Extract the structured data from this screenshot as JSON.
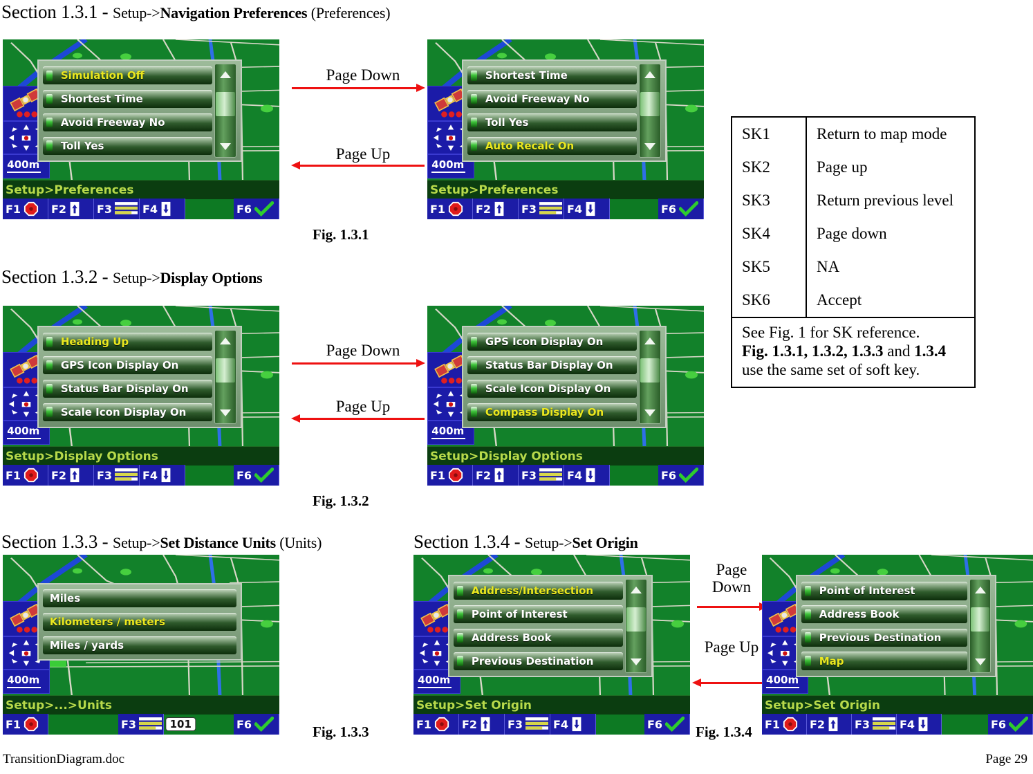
{
  "document": {
    "footer_left": "TransitionDiagram.doc",
    "footer_right": "Page 29"
  },
  "colors": {
    "arrow": "#ee1111",
    "screen_bg": "#12812a",
    "softkey_blue": "#1c1ca6",
    "selected_text": "#ebe81f",
    "status_text": "#b7d94a"
  },
  "sections": {
    "s131": {
      "prefix": "Section 1.3.1 - ",
      "path_plain": "Setup->",
      "path_bold": "Navigation Preferences",
      "suffix": " (Preferences)",
      "caption": "Fig. 1.3.1",
      "arrow_down_label": "Page Down",
      "arrow_up_label": "Page Up"
    },
    "s132": {
      "prefix": "Section 1.3.2 - ",
      "path_plain": "Setup->",
      "path_bold": "Display Options",
      "suffix": "",
      "caption": "Fig. 1.3.2",
      "arrow_down_label": "Page Down",
      "arrow_up_label": "Page Up"
    },
    "s133": {
      "prefix": "Section 1.3.3 - ",
      "path_plain": "Setup->",
      "path_bold": "Set Distance Units",
      "suffix": " (Units)",
      "caption": "Fig. 1.3.3"
    },
    "s134": {
      "prefix": "Section 1.3.4 - ",
      "path_plain": "Setup->",
      "path_bold": "Set Origin",
      "suffix": "",
      "caption": "Fig. 1.3.4",
      "arrow_down_label": "Page\nDown",
      "arrow_up_label": "Page\nUp"
    }
  },
  "screens": {
    "nav_prefs_page1": {
      "status": "Setup>Preferences",
      "scale": "400m",
      "items": [
        {
          "label": "Simulation Off",
          "selected": true
        },
        {
          "label": "Shortest Time",
          "selected": false
        },
        {
          "label": "Avoid Freeway No",
          "selected": false
        },
        {
          "label": "Toll Yes",
          "selected": false
        }
      ],
      "scrollbar": true,
      "softkeys": [
        "F1",
        "F2",
        "F3",
        "F4",
        "F6"
      ]
    },
    "nav_prefs_page2": {
      "status": "Setup>Preferences",
      "scale": "400m",
      "items": [
        {
          "label": "Shortest Time",
          "selected": false
        },
        {
          "label": "Avoid Freeway No",
          "selected": false
        },
        {
          "label": "Toll Yes",
          "selected": false
        },
        {
          "label": "Auto Recalc On",
          "selected": true
        }
      ],
      "scrollbar": true,
      "softkeys": [
        "F1",
        "F2",
        "F3",
        "F4",
        "F6"
      ]
    },
    "display_page1": {
      "status": "Setup>Display Options",
      "scale": "400m",
      "items": [
        {
          "label": "Heading Up",
          "selected": true
        },
        {
          "label": "GPS Icon Display On",
          "selected": false
        },
        {
          "label": "Status Bar Display On",
          "selected": false
        },
        {
          "label": "Scale Icon Display On",
          "selected": false
        }
      ],
      "scrollbar": true,
      "softkeys": [
        "F1",
        "F2",
        "F3",
        "F4",
        "F6"
      ]
    },
    "display_page2": {
      "status": "Setup>Display Options",
      "scale": "400m",
      "items": [
        {
          "label": "GPS Icon Display On",
          "selected": false
        },
        {
          "label": "Status Bar Display On",
          "selected": false
        },
        {
          "label": "Scale Icon Display On",
          "selected": false
        },
        {
          "label": "Compass Display On",
          "selected": true
        }
      ],
      "scrollbar": true,
      "softkeys": [
        "F1",
        "F2",
        "F3",
        "F4",
        "F6"
      ]
    },
    "units": {
      "status": "Setup>...>Units",
      "scale": "400m",
      "items": [
        {
          "label": "Miles",
          "selected": false
        },
        {
          "label": "Kilometers / meters",
          "selected": true
        },
        {
          "label": "Miles / yards",
          "selected": false
        }
      ],
      "scrollbar": false,
      "softkeys": [
        "F1",
        "F3",
        "F6"
      ],
      "shield": "101"
    },
    "origin_page1": {
      "status": "Setup>Set Origin",
      "scale": "400m",
      "items": [
        {
          "label": "Address/Intersection",
          "selected": true
        },
        {
          "label": "Point of Interest",
          "selected": false
        },
        {
          "label": "Address Book",
          "selected": false
        },
        {
          "label": "Previous Destination",
          "selected": false
        }
      ],
      "scrollbar": true,
      "softkeys": [
        "F1",
        "F2",
        "F3",
        "F4",
        "F6"
      ]
    },
    "origin_page2": {
      "status": "Setup>Set Origin",
      "scale": "400m",
      "items": [
        {
          "label": "Point of Interest",
          "selected": false
        },
        {
          "label": "Address Book",
          "selected": false
        },
        {
          "label": "Previous Destination",
          "selected": false
        },
        {
          "label": "Map",
          "selected": true
        }
      ],
      "scrollbar": true,
      "softkeys": [
        "F1",
        "F2",
        "F3",
        "F4",
        "F6"
      ]
    }
  },
  "sk_table": {
    "rows": [
      {
        "key": "SK1",
        "action": "Return to map mode"
      },
      {
        "key": "SK2",
        "action": "Page up"
      },
      {
        "key": "SK3",
        "action": "Return previous level"
      },
      {
        "key": "SK4",
        "action": "Page down"
      },
      {
        "key": "SK5",
        "action": "NA"
      },
      {
        "key": "SK6",
        "action": "Accept"
      }
    ],
    "note_line1": "See Fig. 1 for SK reference.",
    "note_bold1": "Fig. 1.3.1, 1.3.2, 1.3.3",
    "note_mid": " and ",
    "note_bold2": "1.3.4",
    "note_tail": " use the same set of soft key."
  }
}
